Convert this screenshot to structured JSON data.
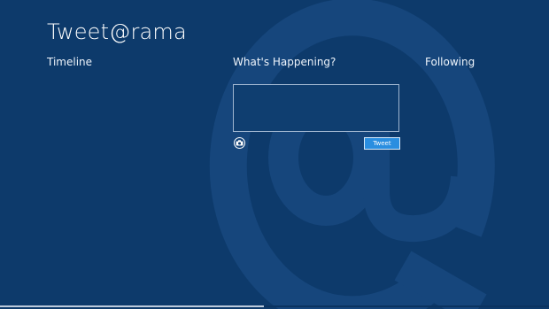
{
  "app": {
    "title": "Tweet@rama"
  },
  "sections": {
    "timeline": "Timeline",
    "whats_happening": "What's Happening?",
    "following": "Following"
  },
  "compose": {
    "value": "",
    "placeholder": "",
    "tweet_label": "Tweet",
    "camera_icon": "camera-icon"
  },
  "scroll": {
    "position_fraction": 0.48
  },
  "colors": {
    "background": "#0d3a6b",
    "watermark": "#154b84",
    "accent": "#2a8ee0"
  }
}
